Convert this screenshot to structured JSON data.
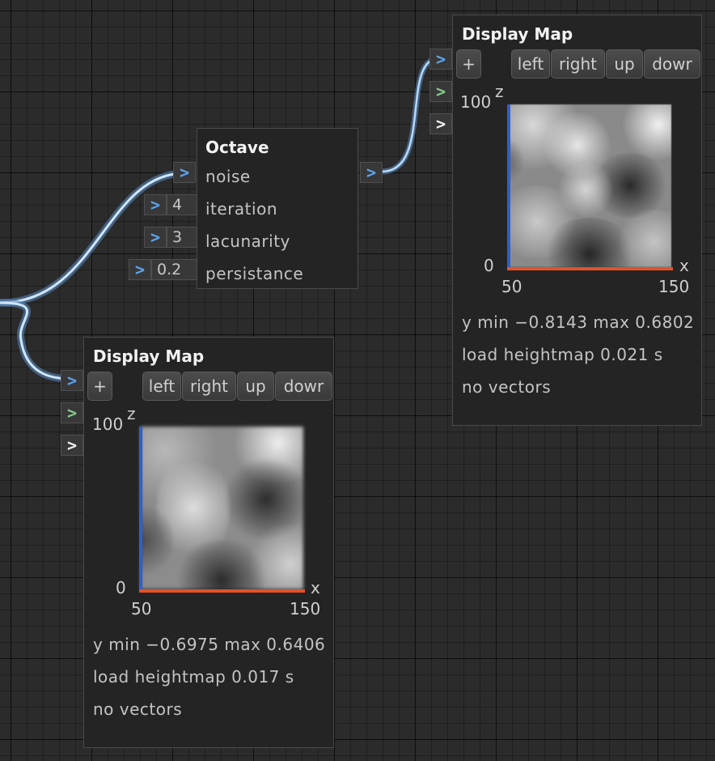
{
  "octave_node": {
    "title": "Octave",
    "inputs": [
      {
        "label": "noise",
        "value": ""
      },
      {
        "label": "iteration",
        "value": "4"
      },
      {
        "label": "lacunarity",
        "value": "3"
      },
      {
        "label": "persistance",
        "value": "0.2"
      }
    ],
    "output_port_icon": ">"
  },
  "display_map_top": {
    "title": "Display Map",
    "buttons": {
      "add": "+",
      "left": "left",
      "right": "right",
      "up": "up",
      "down": "dowr"
    },
    "ports": [
      ">",
      ">",
      ">"
    ],
    "axes": {
      "z_label": "z",
      "x_label": "x",
      "z_max": "100",
      "z_min": "0",
      "x_min": "50",
      "x_max": "150"
    },
    "stats": {
      "y_range": "y min −0.8143 max 0.6802",
      "load": "load heightmap 0.021 s",
      "vectors": "no vectors"
    }
  },
  "display_map_bottom": {
    "title": "Display Map",
    "buttons": {
      "add": "+",
      "left": "left",
      "right": "right",
      "up": "up",
      "down": "dowr"
    },
    "ports": [
      ">",
      ">",
      ">"
    ],
    "axes": {
      "z_label": "z",
      "x_label": "x",
      "z_max": "100",
      "z_min": "0",
      "x_min": "50",
      "x_max": "150"
    },
    "stats": {
      "y_range": "y min −0.6975 max 0.6406",
      "load": "load heightmap 0.017 s",
      "vectors": "no vectors"
    }
  },
  "colors": {
    "background": "#2b2b2b",
    "node": "#242424",
    "wire": "#6aaee8",
    "port_blue": "#5ba4ee",
    "port_green": "#88c98a",
    "axis_z": "#2f5fd0",
    "axis_x": "#e2522b"
  },
  "icons": {
    "input_port": "chevron-right-icon",
    "add": "plus-icon"
  }
}
